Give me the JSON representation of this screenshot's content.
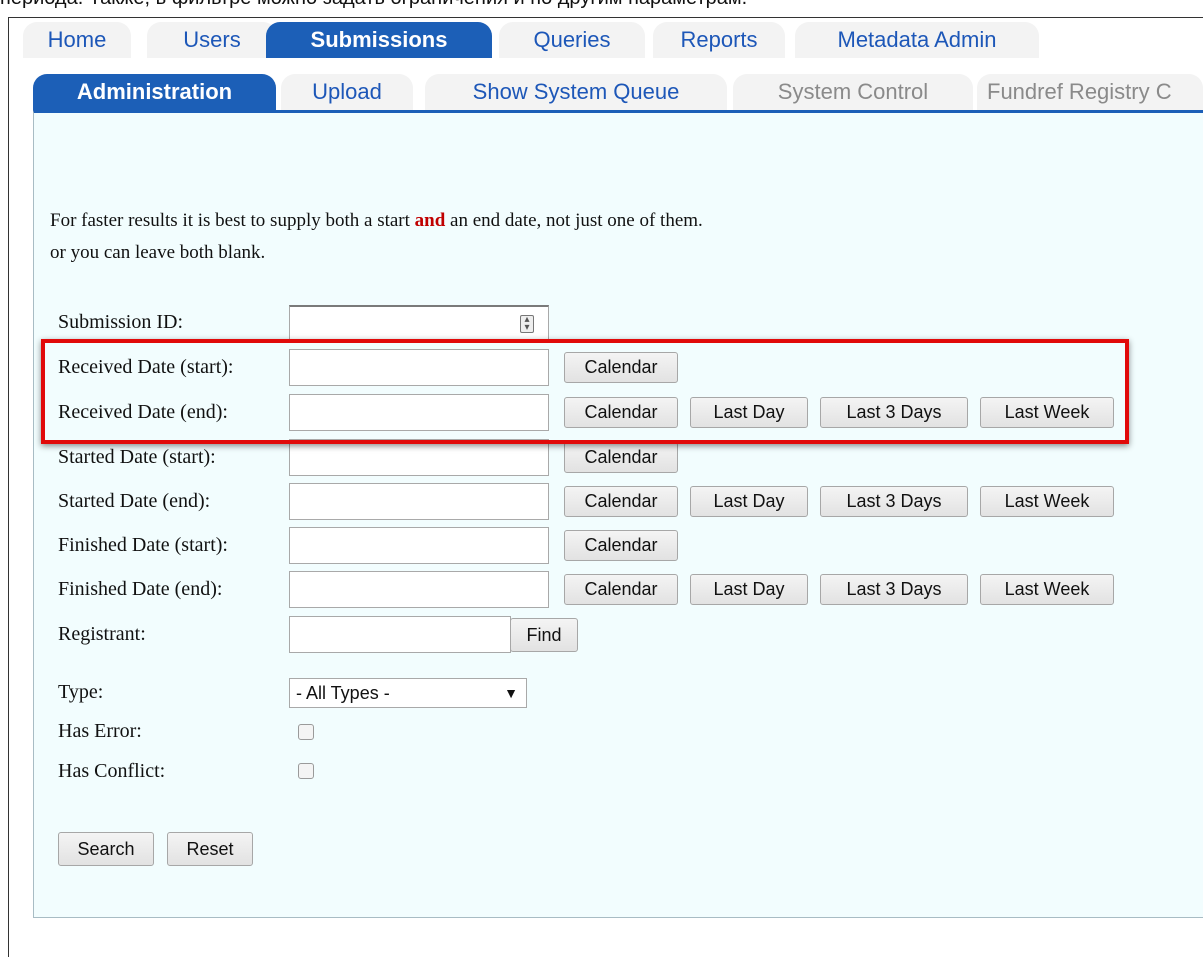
{
  "caption": "периода. Также, в фильтре можно задать ограничения и по другим параметрам.",
  "main_tabs": [
    "Home",
    "Users",
    "Submissions",
    "Queries",
    "Reports",
    "Metadata Admin"
  ],
  "sub_tabs": [
    "Administration",
    "Upload",
    "Show System Queue",
    "System Control",
    "Fundref Registry C"
  ],
  "notice": {
    "line1_before": "For faster results it is best to supply both a start ",
    "line1_highlight": "and",
    "line1_after": " an end date, not just one of them.",
    "line2": "or you can leave both blank."
  },
  "form": {
    "submission_id_label": "Submission ID:",
    "received_start_label": "Received Date (start):",
    "received_end_label": "Received Date (end):",
    "started_start_label": "Started Date (start):",
    "started_end_label": "Started Date (end):",
    "finished_start_label": "Finished Date (start):",
    "finished_end_label": "Finished Date (end):",
    "registrant_label": "Registrant:",
    "type_label": "Type:",
    "has_error_label": "Has Error:",
    "has_conflict_label": "Has Conflict:",
    "type_selected": "- All Types -"
  },
  "buttons": {
    "calendar": "Calendar",
    "last_day": "Last Day",
    "last_3_days": "Last 3 Days",
    "last_week": "Last Week",
    "find": "Find",
    "search": "Search",
    "reset": "Reset"
  },
  "colors": {
    "tab_active": "#1c5fb7",
    "panel": "#f2fdfe",
    "highlight_box": "#e10a0a",
    "emphasis": "#c00000"
  }
}
